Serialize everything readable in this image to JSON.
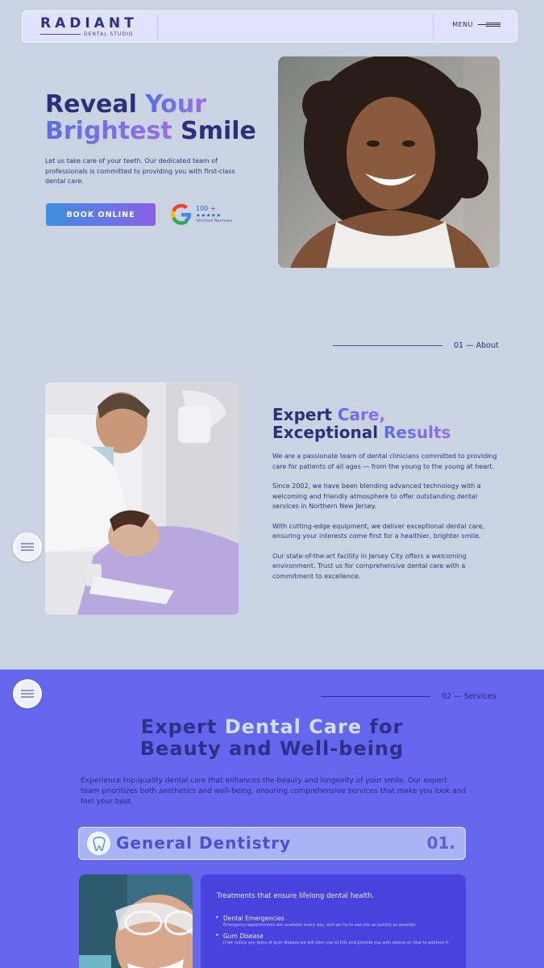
{
  "header": {
    "logo_main": "RADIANT",
    "logo_sub": "DENTAL STUDIO",
    "menu_label": "MENU"
  },
  "hero": {
    "title_part1": "Reveal ",
    "title_part2": "Your",
    "title_part3": "Brightest",
    "title_part4": " Smile",
    "description": "Let us take care of your teeth. Our dedicated team of professionals is committed to providing you with first-class dental care.",
    "cta_label": "BOOK ONLINE",
    "reviews_count": "100 +",
    "reviews_stars": "★★★★★",
    "reviews_label": "Verified Reviews",
    "reviews_rating_stars": 5
  },
  "about": {
    "marker": "01 — About",
    "title_part1": "Expert ",
    "title_part2": "Care,",
    "title_part3": "Exceptional ",
    "title_part4": "Results",
    "paragraphs": [
      "We are a passionate team of dental clinicians committed to providing care for patients of all ages — from the young to the young at heart.",
      "Since 2002, we have been blending advanced technology with a welcoming and friendly atmosphere to offer outstanding dental services in Northern New Jersey.",
      "With cutting-edge equipment, we deliver exceptional dental care, ensuring your interests come first for a healthier, brighter smile.",
      "Our state-of-the-art facility in Jersey City offers a welcoming environment. Trust us for comprehensive dental care with a commitment to excellence."
    ]
  },
  "services": {
    "marker": "02 — Services",
    "title_line1_a": "Expert ",
    "title_line1_b": "Dental Care",
    "title_line1_c": " for",
    "title_line2": "Beauty and Well-being",
    "description": "Experience top-quality dental care that enhances the beauty and longevity of your smile. Our expert team prioritizes both aesthetics and well-being, ensuring comprehensive services that make you look and feel your best.",
    "category": {
      "name": "General Dentistry",
      "number": "01.",
      "icon": "tooth-icon",
      "lead": "Treatments that ensure lifelong dental health.",
      "items": [
        {
          "title": "Dental Emergencies",
          "desc": "Emergency appointments are available every day, and we try to see you as quickly as possible."
        },
        {
          "title": "Gum Disease",
          "desc": "If we notice any signs of gum disease we will alert you to this and provide you with advice on how to address it."
        }
      ]
    }
  },
  "colors": {
    "background": "#c9d3e2",
    "navy": "#2e2f7a",
    "accent_blue": "#5b6de8",
    "accent_violet": "#9a6ee8",
    "services_bg": "#6467ee",
    "services_card": "#4a42de"
  }
}
